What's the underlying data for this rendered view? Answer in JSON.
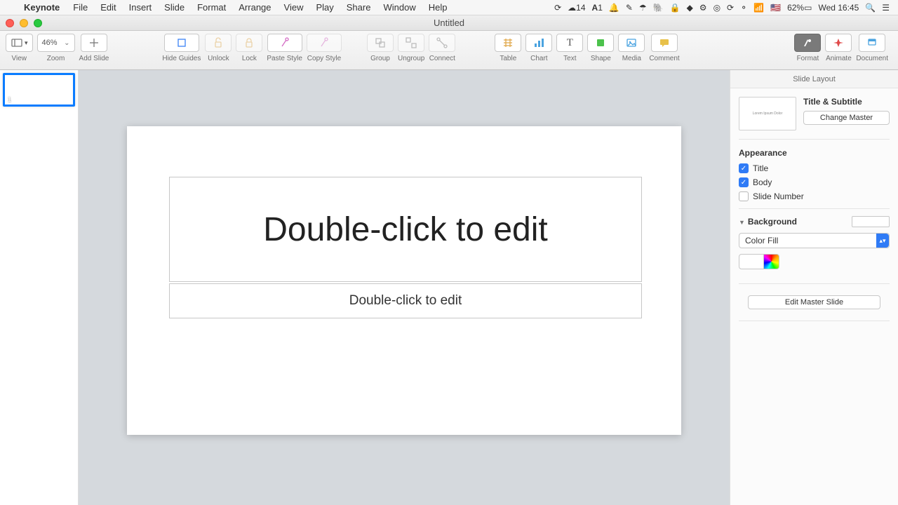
{
  "menubar": {
    "app_name": "Keynote",
    "items": [
      "File",
      "Edit",
      "Insert",
      "Slide",
      "Format",
      "Arrange",
      "View",
      "Play",
      "Share",
      "Window",
      "Help"
    ],
    "status": {
      "cc_count": "14",
      "ai_count": "1",
      "battery": "62%",
      "clock": "Wed 16:45",
      "flag": "🇺🇸"
    }
  },
  "window": {
    "title": "Untitled"
  },
  "toolbar": {
    "view": "View",
    "zoom": "Zoom",
    "zoom_value": "46%",
    "add_slide": "Add Slide",
    "hide_guides": "Hide Guides",
    "unlock": "Unlock",
    "lock": "Lock",
    "paste_style": "Paste Style",
    "copy_style": "Copy Style",
    "group": "Group",
    "ungroup": "Ungroup",
    "connect": "Connect",
    "table": "Table",
    "chart": "Chart",
    "text": "Text",
    "shape": "Shape",
    "media": "Media",
    "comment": "Comment",
    "format": "Format",
    "animate": "Animate",
    "document": "Document"
  },
  "slide_nav": {
    "current_index": "1"
  },
  "canvas": {
    "title_placeholder": "Double-click to edit",
    "body_placeholder": "Double-click to edit"
  },
  "inspector": {
    "header": "Slide Layout",
    "master_preview_text": "Lorem Ipsum Dolor",
    "master_name": "Title & Subtitle",
    "change_master": "Change Master",
    "appearance": "Appearance",
    "chk_title": "Title",
    "chk_body": "Body",
    "chk_slidenum": "Slide Number",
    "background": "Background",
    "fill_type": "Color Fill",
    "edit_master": "Edit Master Slide"
  }
}
